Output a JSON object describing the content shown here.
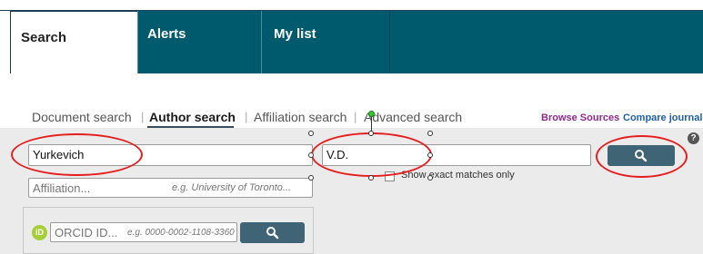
{
  "tabs": [
    {
      "label": "Search",
      "active": true
    },
    {
      "label": "Alerts",
      "active": false
    },
    {
      "label": "My list",
      "active": false
    }
  ],
  "search_nav": {
    "items": [
      {
        "label": "Document search",
        "active": false
      },
      {
        "label": "Author search",
        "active": true
      },
      {
        "label": "Affiliation search",
        "active": false
      },
      {
        "label": "Advanced search",
        "active": false
      }
    ],
    "separator": "|"
  },
  "right_links": {
    "browse_sources": "Browse Sources",
    "compare_journals": "Compare journals"
  },
  "author_form": {
    "last_name_value": "Yurkevich",
    "first_name_value": "V.D.",
    "affiliation_placeholder": "Affiliation...",
    "affiliation_hint": "e.g. University of Toronto...",
    "exact_matches_label": "Show exact matches only",
    "help_symbol": "?"
  },
  "orcid": {
    "placeholder": "ORCID ID...",
    "hint": "e.g. 0000-0002-1108-3360",
    "logo_text": "iD"
  },
  "icons": {
    "search_button": "search-icon",
    "help": "help-icon",
    "orcid": "orcid-icon"
  },
  "colors": {
    "tab_bar": "#005a6e",
    "search_button": "#3e6476",
    "annotation": "#e41e1e",
    "browse_sources": "#8b2a8b",
    "compare_journals": "#1f5fa8",
    "orcid_green": "#a6ce39"
  }
}
